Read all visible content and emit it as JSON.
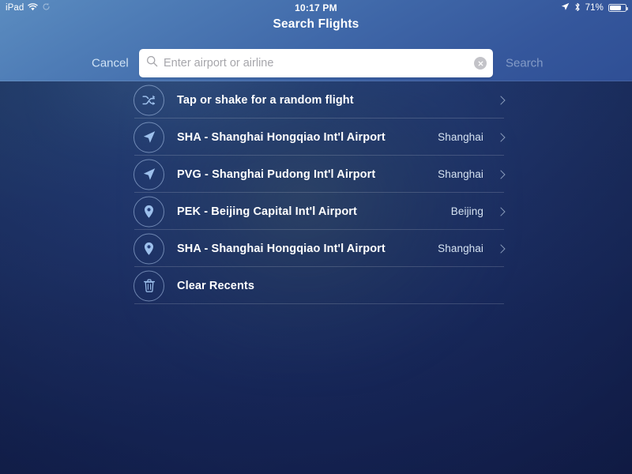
{
  "status_bar": {
    "device": "iPad",
    "wifi_icon": "wifi-icon",
    "sync_icon": "sync-icon",
    "time": "10:17 PM",
    "location_icon": "location-arrow-icon",
    "bluetooth_icon": "bluetooth-icon",
    "battery_percent": "71%",
    "battery_icon": "battery-icon"
  },
  "nav": {
    "title": "Search Flights"
  },
  "search": {
    "cancel_label": "Cancel",
    "search_label": "Search",
    "placeholder": "Enter airport or airline",
    "value": "",
    "search_icon": "search-icon",
    "clear_icon": "clear-circle-icon"
  },
  "results": [
    {
      "icon": "shuffle-icon",
      "label": "Tap or shake for a random flight",
      "sub": "",
      "chevron": true
    },
    {
      "icon": "navigation-arrow-icon",
      "label": "SHA - Shanghai Hongqiao Int'l Airport",
      "sub": "Shanghai",
      "chevron": true
    },
    {
      "icon": "navigation-arrow-icon",
      "label": "PVG - Shanghai Pudong Int'l Airport",
      "sub": "Shanghai",
      "chevron": true
    },
    {
      "icon": "map-pin-icon",
      "label": "PEK - Beijing Capital Int'l Airport",
      "sub": "Beijing",
      "chevron": true
    },
    {
      "icon": "map-pin-icon",
      "label": "SHA - Shanghai Hongqiao Int'l Airport",
      "sub": "Shanghai",
      "chevron": true
    },
    {
      "icon": "trash-icon",
      "label": "Clear Recents",
      "sub": "",
      "chevron": false
    }
  ],
  "colors": {
    "accent_icon": "#8fb6e6",
    "header_blue": "#4a7cb6",
    "background_navy": "#1f3470",
    "text_primary": "#ffffff",
    "text_secondary": "#d6e3f2"
  }
}
